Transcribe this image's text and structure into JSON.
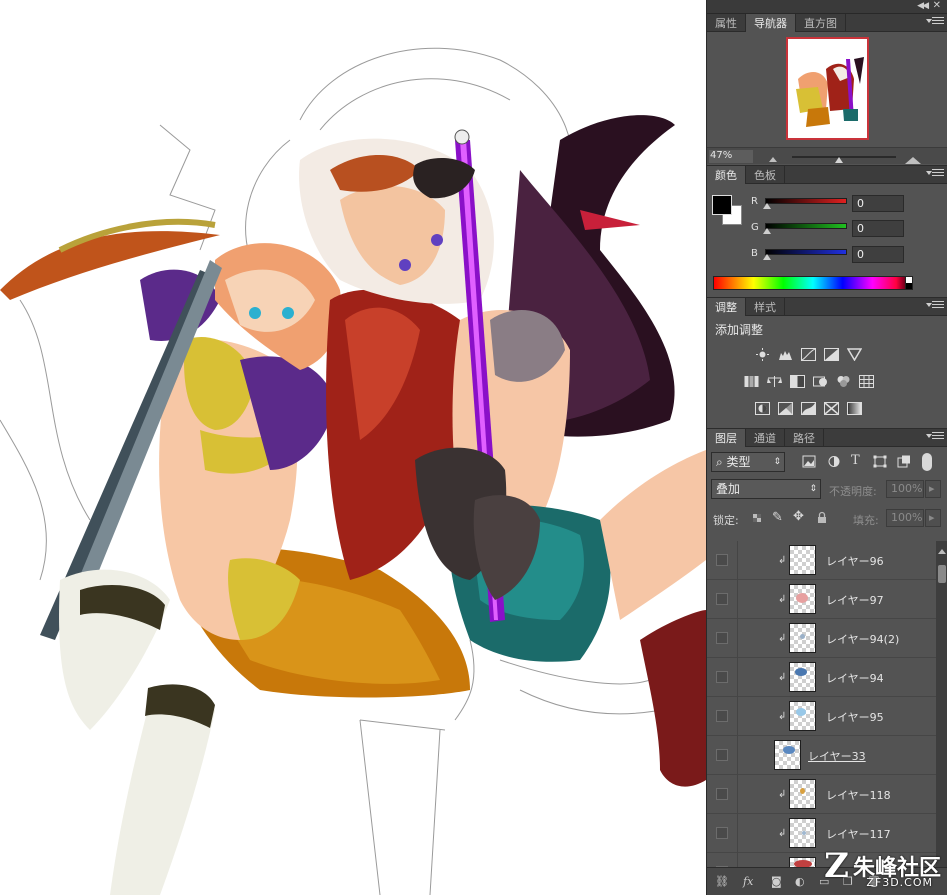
{
  "canvas": {
    "image": "illustration-artwork"
  },
  "dock": {
    "topbar_icons": [
      "collapse-icon",
      "close-icon"
    ]
  },
  "navigator_panel": {
    "tabs": [
      {
        "label": "属性",
        "active": false
      },
      {
        "label": "导航器",
        "active": true
      },
      {
        "label": "直方图",
        "active": false
      }
    ],
    "zoom": "47%"
  },
  "color_panel": {
    "tabs": [
      {
        "label": "颜色",
        "active": true
      },
      {
        "label": "色板",
        "active": false
      }
    ],
    "channels": [
      {
        "label": "R",
        "value": "0",
        "color": "#e02020"
      },
      {
        "label": "G",
        "value": "0",
        "color": "#20c020"
      },
      {
        "label": "B",
        "value": "0",
        "color": "#2030e0"
      }
    ],
    "foreground": "#000000",
    "background": "#ffffff"
  },
  "adjustments_panel": {
    "tabs": [
      {
        "label": "调整",
        "active": true
      },
      {
        "label": "样式",
        "active": false
      }
    ],
    "title": "添加调整",
    "icons": [
      [
        "brightness-icon",
        "levels-icon",
        "curves-icon",
        "exposure-icon",
        "vibrance-icon"
      ],
      [
        "hue-saturation-icon",
        "color-balance-icon",
        "black-white-icon",
        "photo-filter-icon",
        "channel-mixer-icon",
        "color-lookup-icon"
      ],
      [
        "invert-icon",
        "posterize-icon",
        "threshold-icon",
        "selective-color-icon",
        "gradient-map-icon"
      ]
    ]
  },
  "layers_panel": {
    "tabs": [
      {
        "label": "图层",
        "active": true
      },
      {
        "label": "通道",
        "active": false
      },
      {
        "label": "路径",
        "active": false
      }
    ],
    "filter_kind": "类型",
    "blend_mode": "叠加",
    "opacity_label": "不透明度:",
    "opacity_value": "100%",
    "lock_label": "锁定:",
    "fill_label": "填充:",
    "fill_value": "100%",
    "layers": [
      {
        "name": "レイヤー96",
        "clipped": true
      },
      {
        "name": "レイヤー97",
        "clipped": true
      },
      {
        "name": "レイヤー94(2)",
        "clipped": true
      },
      {
        "name": "レイヤー94",
        "clipped": true
      },
      {
        "name": "レイヤー95",
        "clipped": true
      },
      {
        "name": "レイヤー33",
        "clipped": false
      },
      {
        "name": "レイヤー118",
        "clipped": true
      },
      {
        "name": "レイヤー117",
        "clipped": true
      }
    ],
    "footer_icons": [
      "link-icon",
      "fx-icon",
      "mask-icon",
      "adjustment-layer-icon",
      "group-icon",
      "new-layer-icon",
      "trash-icon"
    ]
  },
  "watermark": {
    "brand": "朱峰社区",
    "domain": "ZF3D.COM"
  }
}
